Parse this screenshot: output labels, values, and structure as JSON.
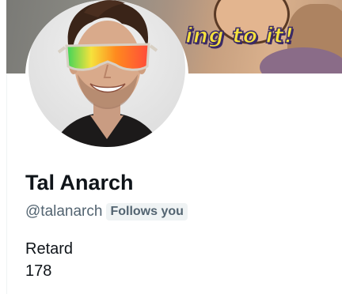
{
  "banner": {
    "text": "ing to it!"
  },
  "profile": {
    "display_name": "Tal Anarch",
    "handle": "@talanarch",
    "follows_you_badge": "Follows you",
    "bio_line1": "Retard",
    "bio_line2": "178"
  },
  "colors": {
    "text_primary": "#0f1419",
    "text_secondary": "#536471",
    "badge_bg": "#eff3f4",
    "banner_text": "#f6e23c"
  }
}
